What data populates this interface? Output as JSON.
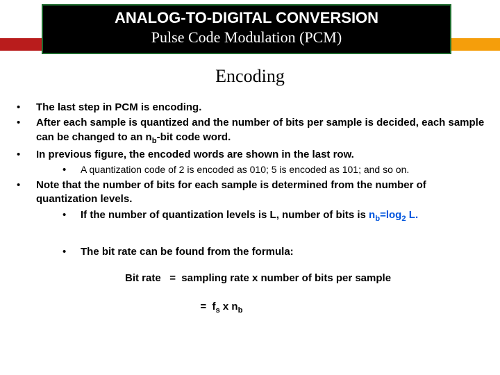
{
  "header": {
    "title": "ANALOG-TO-DIGITAL CONVERSION",
    "subtitle": "Pulse Code Modulation (PCM)"
  },
  "section_heading": "Encoding",
  "bullets": {
    "b1": "The last step in PCM is encoding.",
    "b2_pre": "After each sample is quantized and the number of bits per sample is decided, each sample can be changed to an n",
    "b2_sub": "b",
    "b2_post": "-bit code word.",
    "b3": "In previous figure, the encoded words are shown in the last row.",
    "b3a": "A quantization code of 2 is encoded as 010; 5 is encoded as 101; and so on.",
    "b4": "Note that the number of bits for each sample is determined from the number of quantization levels.",
    "b4a_pre": "If the number of quantization levels is L, number of bits is ",
    "b4a_formula_nb": "n",
    "b4a_formula_nb_sub": "b",
    "b4a_formula_eq": "=log",
    "b4a_formula_eq_sub": "2",
    "b4a_formula_post": " L.",
    "b5": "The bit rate can be found from the formula:"
  },
  "formula": {
    "label": "Bit rate ",
    "line1": "  =  sampling rate x number of bits per sample",
    "line2_pre": "  =  f",
    "line2_s": "s",
    "line2_mid": " x n",
    "line2_b": "b"
  },
  "bullet_glyph": "•"
}
